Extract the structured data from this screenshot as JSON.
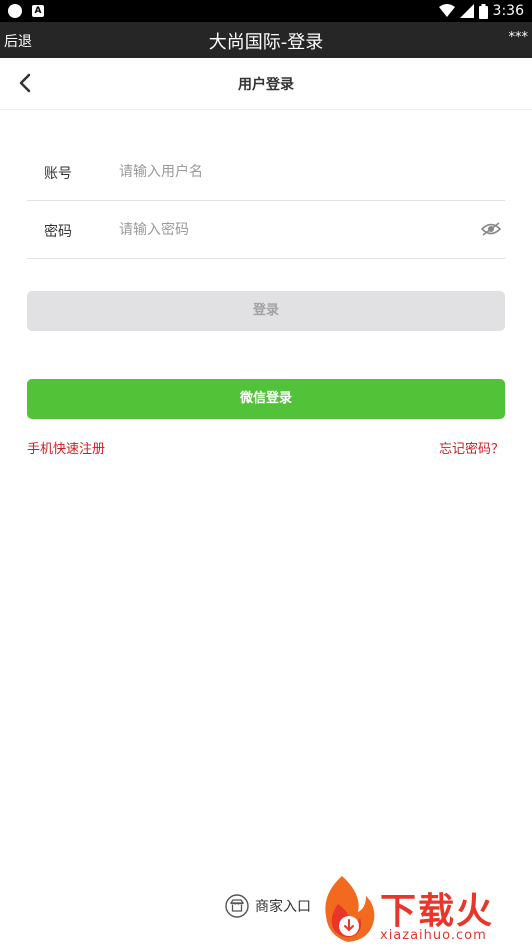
{
  "status_bar": {
    "time": "3:36",
    "icons": [
      "circle-notification-icon",
      "a-notification-icon",
      "wifi-icon",
      "signal-icon",
      "battery-icon"
    ]
  },
  "webview_bar": {
    "back_label": "后退",
    "title": "大尚国际-登录",
    "more_label": "***"
  },
  "header": {
    "title": "用户登录",
    "back_icon": "chevron-left-icon"
  },
  "form": {
    "account": {
      "label": "账号",
      "placeholder": "请输入用户名",
      "value": ""
    },
    "password": {
      "label": "密码",
      "placeholder": "请输入密码",
      "value": "",
      "toggle_icon": "eye-icon"
    }
  },
  "buttons": {
    "login": "登录",
    "wechat_login": "微信登录"
  },
  "links": {
    "register": "手机快速注册",
    "forgot": "忘记密码？"
  },
  "merchant": {
    "label": "商家入口",
    "icon": "shop-icon"
  },
  "watermark": {
    "text": "下载火",
    "url": "xiazaihuo.com"
  },
  "colors": {
    "status_bar": "#000000",
    "webview_bar": "#262626",
    "login_button_bg": "#e1e1e3",
    "login_button_text": "#a2a2a2",
    "wechat_green": "#52c238",
    "link_red": "#cf1d1f",
    "watermark_red": "#e8362b"
  }
}
